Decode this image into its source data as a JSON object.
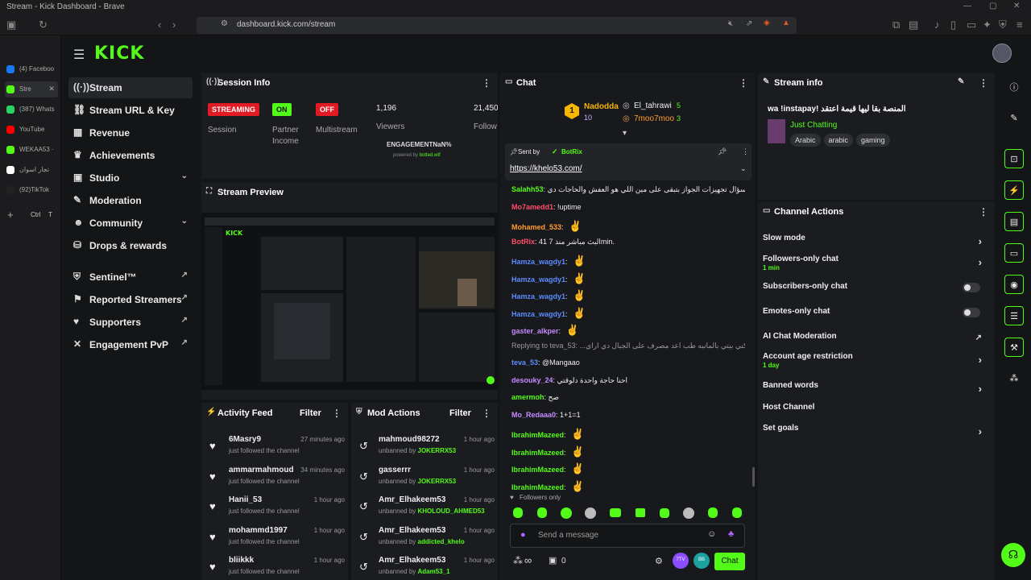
{
  "browser": {
    "window_title": "Stream - Kick Dashboard - Brave",
    "url": "dashboard.kick.com/stream",
    "tabs": [
      {
        "label": "(4) Faceboo",
        "color": "#1877f2"
      },
      {
        "label": "Stre",
        "color": "#53fc18"
      },
      {
        "label": "(387) Whats",
        "color": "#25d366"
      },
      {
        "label": "YouTube",
        "color": "#ff0000"
      },
      {
        "label": "WEKAA53 ·",
        "color": "#53fc18"
      },
      {
        "label": "تجار اسوان",
        "color": "#ffffff"
      },
      {
        "label": "(92)TikTok",
        "color": "#222222"
      }
    ],
    "new_tab": "+",
    "ctrl_hint": "Ctrl",
    "t_hint": "T"
  },
  "header": {
    "logo": "KICK"
  },
  "nav": {
    "items": [
      {
        "label": "Stream",
        "icon": "stream-icon",
        "active": true
      },
      {
        "label": "Stream URL & Key",
        "icon": "link-icon"
      },
      {
        "label": "Revenue",
        "icon": "revenue-icon"
      },
      {
        "label": "Achievements",
        "icon": "trophy-icon"
      },
      {
        "label": "Studio",
        "icon": "studio-icon",
        "chevron": "⌄"
      },
      {
        "label": "Moderation",
        "icon": "wrench-icon"
      },
      {
        "label": "Community",
        "icon": "community-icon",
        "chevron": "⌄"
      },
      {
        "label": "Drops & rewards",
        "icon": "drops-icon"
      },
      {
        "label": "Sentinel™",
        "icon": "shield-icon",
        "ext": "↗"
      },
      {
        "label": "Reported Streamers",
        "icon": "flag-icon",
        "ext": "↗"
      },
      {
        "label": "Supporters",
        "icon": "heart-icon",
        "ext": "↗"
      },
      {
        "label": "Engagement PvP",
        "icon": "swords-icon",
        "ext": "↗"
      }
    ]
  },
  "session": {
    "title": "Session Info",
    "streaming_badge": "STREAMING",
    "streaming_label": "Session",
    "on_badge": "ON",
    "on_label1": "Partner",
    "on_label2": "Income",
    "off_badge": "OFF",
    "off_label": "Multistream",
    "viewers_value": "1,196",
    "viewers_label": "Viewers",
    "follow_value": "21,450",
    "follow_label": "Follow",
    "engagement": "ENGAGEMENTNaN%",
    "powered": "powered by ",
    "powered_brand": "botted.wtf"
  },
  "preview": {
    "title": "Stream Preview"
  },
  "activity": {
    "title": "Activity Feed",
    "filter": "Filter",
    "items": [
      {
        "name": "6Masry9",
        "sub": "just followed the channel",
        "time": "27 minutes ago"
      },
      {
        "name": "ammarmahmoud",
        "sub": "just followed the channel",
        "time": "34 minutes ago"
      },
      {
        "name": "Hanii_53",
        "sub": "just followed the channel",
        "time": "1 hour ago"
      },
      {
        "name": "mohammd1997",
        "sub": "just followed the channel",
        "time": "1 hour ago"
      },
      {
        "name": "bliikkk",
        "sub": "just followed the channel",
        "time": "1 hour ago"
      }
    ]
  },
  "mod": {
    "title": "Mod Actions",
    "filter": "Filter",
    "items": [
      {
        "name": "mahmoud98272",
        "action": "unbanned by ",
        "by": "JOKERRX53",
        "time": "1 hour ago"
      },
      {
        "name": "gasserrr",
        "action": "unbanned by ",
        "by": "JOKERRX53",
        "time": "1 hour ago"
      },
      {
        "name": "Amr_Elhakeem53",
        "action": "unbanned by ",
        "by": "KHOLOUD_AHMED53",
        "time": "1 hour ago"
      },
      {
        "name": "Amr_Elhakeem53",
        "action": "unbanned by ",
        "by": "addicted_khelo",
        "time": "1 hour ago"
      },
      {
        "name": "Amr_Elhakeem53",
        "action": "unbanned by ",
        "by": "Adam53_1",
        "time": "1 hour ago"
      }
    ]
  },
  "chat": {
    "title": "Chat",
    "leaders": [
      {
        "name": "Nadodda",
        "score": "10"
      },
      {
        "name": "El_tahrawi",
        "score": "5"
      },
      {
        "name": "7moo7moo",
        "score": "3"
      }
    ],
    "pinned": {
      "sent_by": "Sent by",
      "bot": "BotRix",
      "link": "https://khelo53.com/"
    },
    "messages": [
      {
        "user": "Salahh53",
        "color": "#53fc18",
        "text": "طب سؤال تجهيزات الجواز بتبقى على مين اللي هو العفش والحاجات دي"
      },
      {
        "user": "Mo7amedd1",
        "color": "#ff4d6a",
        "text": "!uptime"
      },
      {
        "user": "Mohamed_533",
        "color": "#ff9d2e",
        "text": "",
        "emote": true
      },
      {
        "user": "BotRix",
        "color": "#ff4d6a",
        "text": "البث مباشر منذ 7 41min."
      },
      {
        "user": "Hamza_wagdy1",
        "color": "#5b8cff",
        "text": "",
        "emote": true
      },
      {
        "user": "Hamza_wagdy1",
        "color": "#5b8cff",
        "text": "",
        "emote": true
      },
      {
        "user": "Hamza_wagdy1",
        "color": "#5b8cff",
        "text": "",
        "emote": true
      },
      {
        "user": "Hamza_wagdy1",
        "color": "#5b8cff",
        "text": "",
        "emote": true
      },
      {
        "user": "gaster_alkper",
        "color": "#c68cff",
        "text": "",
        "emote": true
      },
      {
        "user": "",
        "color": "#999999",
        "text": "Replying to teva_53: ...ون وانكده و انا مكني بيتي بالمانيه طب اعد مصرف على الجبال دي اراي"
      },
      {
        "user": "teva_53",
        "color": "#5b8cff",
        "text": "@Mangaao"
      },
      {
        "user": "desouky_24",
        "color": "#c68cff",
        "text": "احنا حاجة واحدة دلوقتي"
      },
      {
        "user": "amermoh",
        "color": "#53fc18",
        "text": "صح"
      },
      {
        "user": "Mo_Redaaa0",
        "color": "#c68cff",
        "text": "1+1=1"
      },
      {
        "user": "IbrahimMazeed",
        "color": "#53fc18",
        "text": "",
        "emote": true
      },
      {
        "user": "IbrahimMazeed",
        "color": "#53fc18",
        "text": "",
        "emote": true
      },
      {
        "user": "IbrahimMazeed",
        "color": "#53fc18",
        "text": "",
        "emote": true
      },
      {
        "user": "IbrahimMazeed",
        "color": "#53fc18",
        "text": "",
        "emote": true
      }
    ],
    "followers_only": "Followers only",
    "placeholder": "Send a message",
    "points": "0",
    "send": "Chat",
    "infinity": "∞"
  },
  "info": {
    "title": "Stream info",
    "stream_title": "wa !instapay! المنصة بقا ليها قيمة اعتقد",
    "category": "Just Chatting",
    "tags": [
      "Arabic",
      "arabic",
      "gaming"
    ]
  },
  "actions": {
    "title": "Channel Actions",
    "items": [
      {
        "label": "Slow mode",
        "sub": "",
        "ctl": "arrow"
      },
      {
        "label": "Followers-only chat",
        "sub": "1 min",
        "ctl": "arrow"
      },
      {
        "label": "Subscribers-only chat",
        "sub": "",
        "ctl": "toggle"
      },
      {
        "label": "Emotes-only chat",
        "sub": "",
        "ctl": "toggle"
      },
      {
        "label": "AI Chat Moderation",
        "sub": "",
        "ctl": "ext"
      },
      {
        "label": "Account age restriction",
        "sub": "1 day",
        "ctl": "arrow"
      },
      {
        "label": "Banned words",
        "sub": "",
        "ctl": "arrow"
      },
      {
        "label": "Host Channel",
        "sub": "",
        "ctl": "none"
      },
      {
        "label": "Set goals",
        "sub": "",
        "ctl": "arrow"
      }
    ]
  },
  "colors": {
    "accent": "#53fc18",
    "red": "#e01b24"
  }
}
